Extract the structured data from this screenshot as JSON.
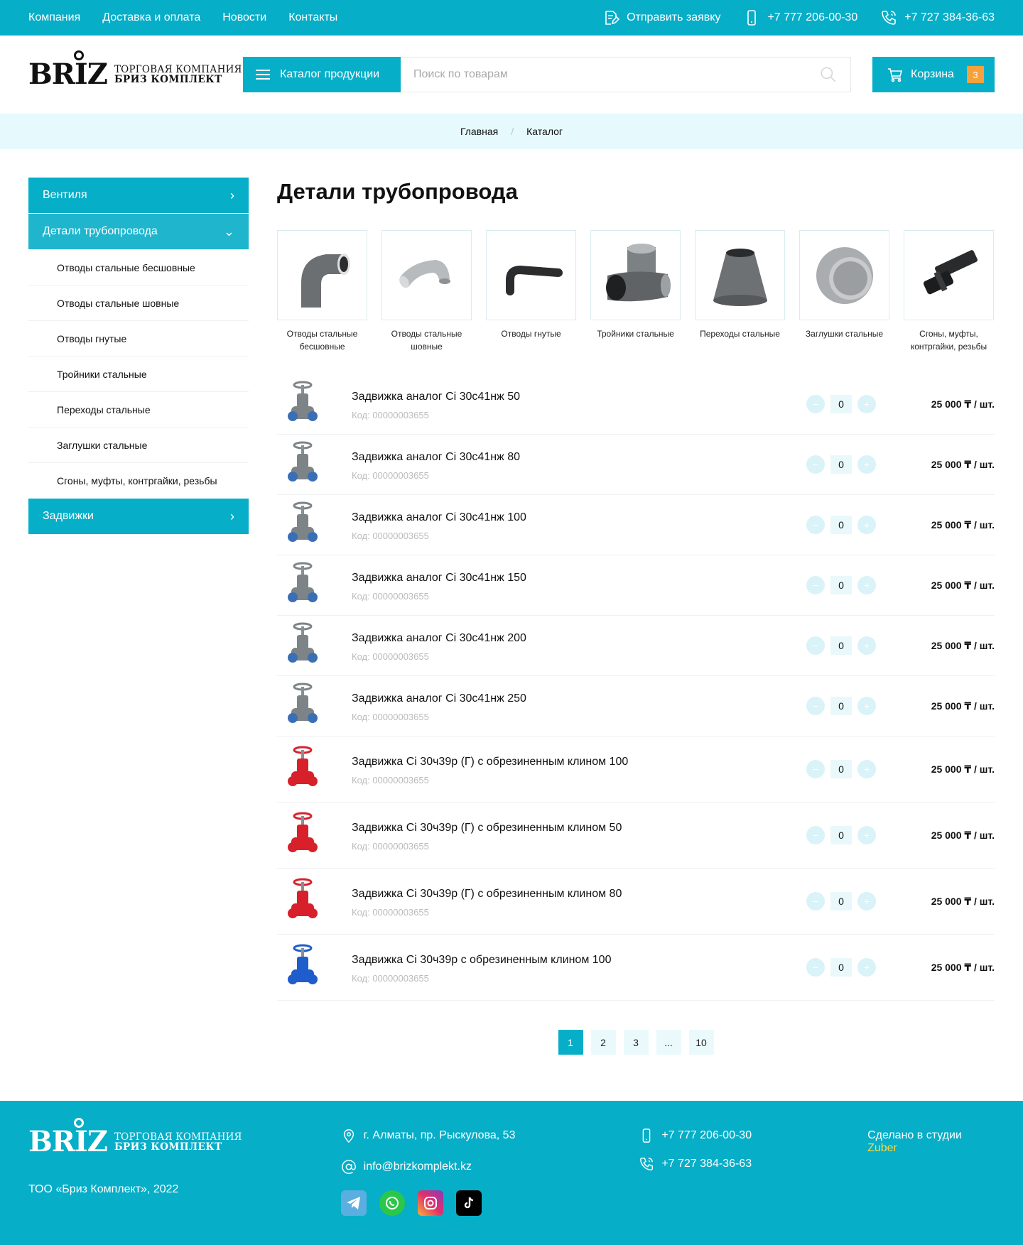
{
  "topbar": {
    "nav": [
      "Компания",
      "Доставка и оплата",
      "Новости",
      "Контакты"
    ],
    "request_label": "Отправить заявку",
    "phone_mobile": "+7 777 206-00-30",
    "phone_office": "+7 727 384-36-63"
  },
  "header": {
    "logo_text": "BRIZ",
    "logo_line1": "ТОРГОВАЯ КОМПАНИЯ",
    "logo_line2": "БРИЗ КОМПЛЕКТ",
    "catalog_label": "Каталог продукции",
    "search_placeholder": "Поиск по товарам",
    "cart_label": "Корзина",
    "cart_count": "3"
  },
  "breadcrumb": [
    "Главная",
    "Каталог"
  ],
  "sidebar": {
    "sections": [
      {
        "label": "Вентиля"
      },
      {
        "label": "Детали трубопровода"
      },
      {
        "label": "Задвижки"
      }
    ],
    "subitems": [
      "Отводы стальные бесшовные",
      "Отводы стальные шовные",
      "Отводы гнутые",
      "Тройники стальные",
      "Переходы стальные",
      "Заглушки стальные",
      "Сгоны, муфты, контргайки, резьбы"
    ]
  },
  "page_title": "Детали трубопровода",
  "categories": [
    {
      "label": "Отводы стальные бесшовные",
      "icon": "elbow-icon"
    },
    {
      "label": "Отводы стальные шовные",
      "icon": "elbow-shiny-icon"
    },
    {
      "label": "Отводы гнутые",
      "icon": "bent-pipe-icon"
    },
    {
      "label": "Тройники стальные",
      "icon": "tee-icon"
    },
    {
      "label": "Переходы стальные",
      "icon": "reducer-icon"
    },
    {
      "label": "Заглушки стальные",
      "icon": "cap-icon"
    },
    {
      "label": "Сгоны, муфты, контргайки, резьбы",
      "icon": "nipple-icon"
    }
  ],
  "products": [
    {
      "name": "Задвижка аналог Ci 30с41нж 50",
      "code": "Код: 00000003655",
      "qty": "0",
      "price": "25 000 ₸ / шт.",
      "valve": "grey"
    },
    {
      "name": "Задвижка аналог Ci 30с41нж 80",
      "code": "Код: 00000003655",
      "qty": "0",
      "price": "25 000 ₸ / шт.",
      "valve": "grey"
    },
    {
      "name": "Задвижка аналог Ci 30с41нж 100",
      "code": "Код: 00000003655",
      "qty": "0",
      "price": "25 000 ₸ / шт.",
      "valve": "grey"
    },
    {
      "name": "Задвижка аналог Ci 30с41нж 150",
      "code": "Код: 00000003655",
      "qty": "0",
      "price": "25 000 ₸ / шт.",
      "valve": "grey"
    },
    {
      "name": "Задвижка аналог Ci 30с41нж 200",
      "code": "Код: 00000003655",
      "qty": "0",
      "price": "25 000 ₸ / шт.",
      "valve": "grey"
    },
    {
      "name": "Задвижка аналог Ci 30с41нж 250",
      "code": "Код: 00000003655",
      "qty": "0",
      "price": "25 000 ₸ / шт.",
      "valve": "grey"
    },
    {
      "name": "Задвижка Ci 30ч39р (Г) с обрезиненным клином 100",
      "code": "Код: 00000003655",
      "qty": "0",
      "price": "25 000 ₸ / шт.",
      "valve": "red"
    },
    {
      "name": "Задвижка Ci 30ч39р (Г) с обрезиненным клином 50",
      "code": "Код: 00000003655",
      "qty": "0",
      "price": "25 000 ₸ / шт.",
      "valve": "red"
    },
    {
      "name": "Задвижка Ci 30ч39р (Г) с обрезиненным клином 80",
      "code": "Код: 00000003655",
      "qty": "0",
      "price": "25 000 ₸ / шт.",
      "valve": "red"
    },
    {
      "name": "Задвижка Ci 30ч39р с обрезиненным клином 100",
      "code": "Код: 00000003655",
      "qty": "0",
      "price": "25 000 ₸ / шт.",
      "valve": "blue"
    }
  ],
  "pagination": [
    "1",
    "2",
    "3",
    "...",
    "10"
  ],
  "pagination_active": "1",
  "footer": {
    "copyright": "ТОО «Бриз Комплект», 2022",
    "address": "г. Алматы, пр. Рыскулова, 53",
    "email": "info@brizkomplekt.kz",
    "phone_mobile": "+7 777 206-00-30",
    "phone_office": "+7 727 384-36-63",
    "made_by": "Сделано в студии",
    "studio": "Zuber"
  },
  "colors": {
    "accent": "#06aec8",
    "badge": "#f5a23c",
    "breadcrumb_bg": "#e6fafd",
    "studio": "#ffd93b"
  }
}
